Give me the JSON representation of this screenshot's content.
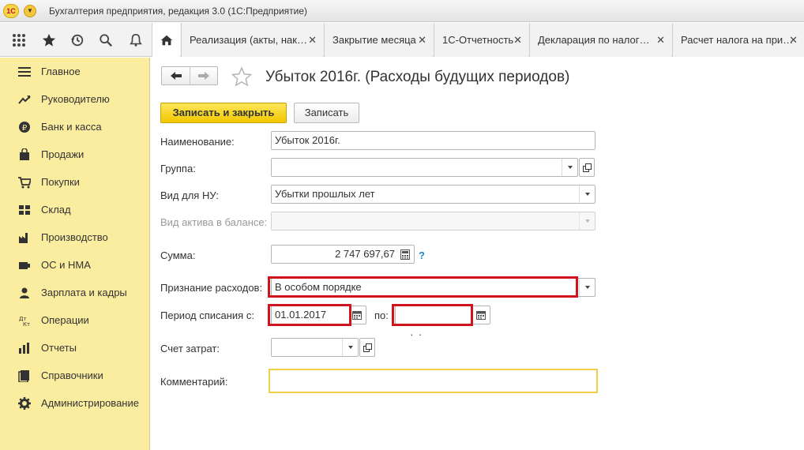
{
  "app": {
    "logo_text": "1C",
    "title": "Бухгалтерия предприятия, редакция 3.0  (1С:Предприятие)"
  },
  "tabs": [
    {
      "label": "Реализация (акты, нак…"
    },
    {
      "label": "Закрытие месяца"
    },
    {
      "label": "1С-Отчетность"
    },
    {
      "label": "Декларация по налог…"
    },
    {
      "label": "Расчет налога на при…"
    }
  ],
  "sidebar": {
    "items": [
      {
        "label": "Главное",
        "icon": "menu-lines-icon"
      },
      {
        "label": "Руководителю",
        "icon": "trend-icon"
      },
      {
        "label": "Банк и касса",
        "icon": "coin-icon"
      },
      {
        "label": "Продажи",
        "icon": "shopping-bag-icon"
      },
      {
        "label": "Покупки",
        "icon": "cart-icon"
      },
      {
        "label": "Склад",
        "icon": "warehouse-icon"
      },
      {
        "label": "Производство",
        "icon": "factory-icon"
      },
      {
        "label": "ОС и НМА",
        "icon": "assets-icon"
      },
      {
        "label": "Зарплата и кадры",
        "icon": "person-icon"
      },
      {
        "label": "Операции",
        "icon": "dt-kt-icon"
      },
      {
        "label": "Отчеты",
        "icon": "bar-chart-icon"
      },
      {
        "label": "Справочники",
        "icon": "catalog-icon"
      },
      {
        "label": "Администрирование",
        "icon": "gear-icon"
      }
    ]
  },
  "document": {
    "title": "Убыток 2016г. (Расходы будущих периодов)",
    "save_close_label": "Записать и закрыть",
    "save_label": "Записать"
  },
  "form": {
    "name_label": "Наименование:",
    "name_value": "Убыток 2016г.",
    "group_label": "Группа:",
    "group_value": "",
    "nu_type_label": "Вид для НУ:",
    "nu_type_value": "Убытки прошлых лет",
    "asset_type_label": "Вид актива в балансе:",
    "asset_type_value": "",
    "sum_label": "Сумма:",
    "sum_value": "2 747 697,67",
    "help_text": "?",
    "recognition_label": "Признание расходов:",
    "recognition_value": "В особом порядке",
    "period_label": "Период списания с:",
    "period_from_value": "01.01.2017",
    "period_to_label": "по:",
    "period_to_value": "  .  .",
    "cost_account_label": "Счет затрат:",
    "cost_account_value": "",
    "comment_label": "Комментарий:",
    "comment_value": ""
  },
  "colors": {
    "sidebar_bg": "#fbeda0",
    "primary_button": "#f3c800",
    "highlight_red": "#d0141e",
    "comment_border": "#f0cf48"
  }
}
